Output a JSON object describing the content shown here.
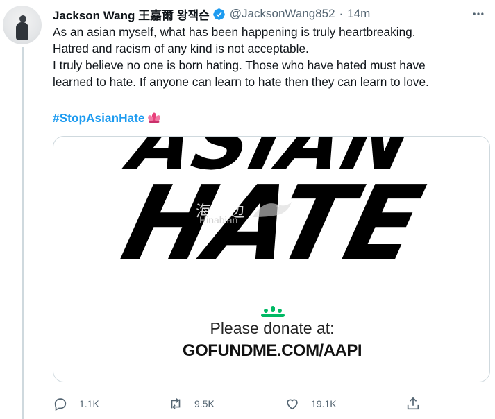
{
  "tweet": {
    "author_name": "Jackson Wang 王嘉爾 왕잭슨",
    "handle": "@JacksonWang852",
    "separator": "·",
    "time": "14m",
    "lines": [
      "As an asian myself, what has been happening is truly heartbreaking.",
      "Hatred and racism of any kind is not acceptable.",
      "I truly believe no one is born hating. Those who have hated must have",
      "learned to hate. If anyone can learn to hate then they can learn to love."
    ],
    "hashtag": "#StopAsianHate"
  },
  "card": {
    "poster_line1": "ASIAN",
    "poster_line2": "HATE",
    "watermark_cn": "海那边",
    "watermark_en": "Hinabian",
    "donate_text": "Please donate at:",
    "url": "GOFUNDME.COM/AAPI",
    "logo_color": "#00b964"
  },
  "actions": {
    "replies": "1.1K",
    "retweets": "9.5K",
    "likes": "19.1K"
  },
  "colors": {
    "accent": "#1d9bf0",
    "muted": "#536471",
    "border": "#cfd9de"
  }
}
